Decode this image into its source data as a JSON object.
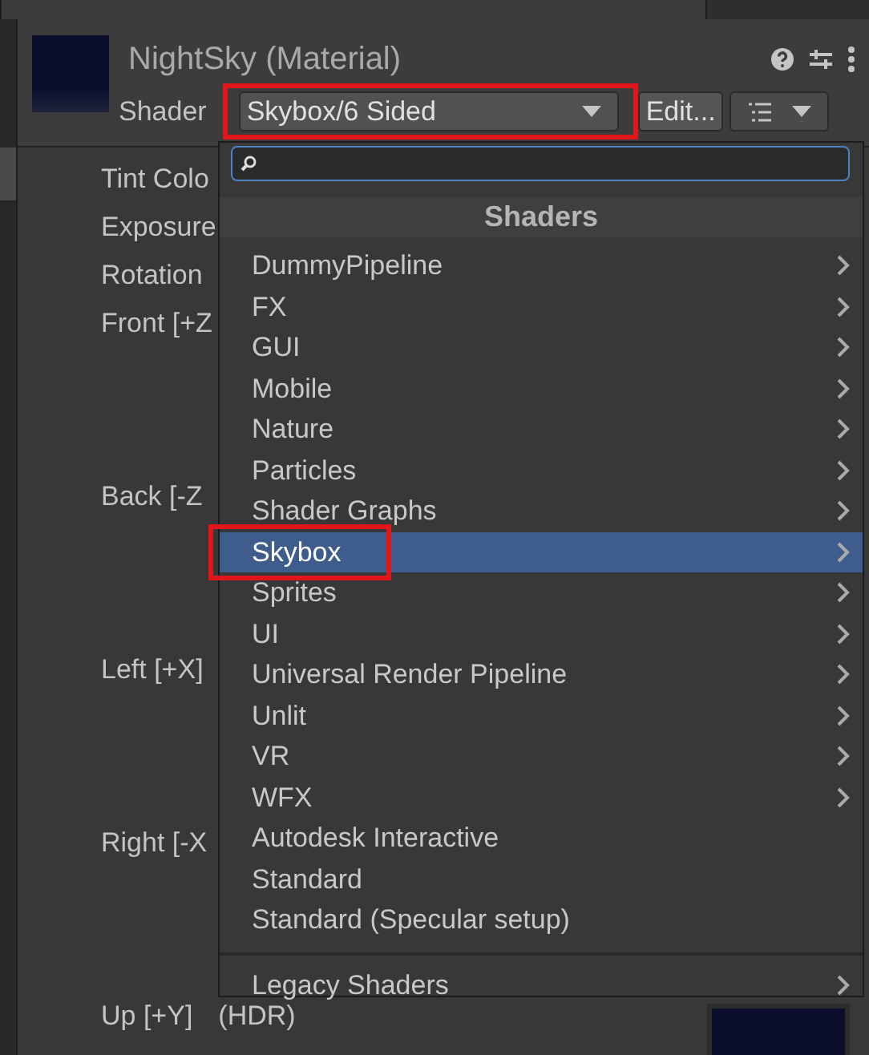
{
  "tabs": [
    {
      "selected": true
    },
    {
      "selected": false
    }
  ],
  "material": {
    "title": "NightSky (Material)",
    "shader_label": "Shader",
    "shader_value": "Skybox/6 Sided",
    "edit_button": "Edit..."
  },
  "properties": [
    {
      "label": "Tint Colo",
      "kind": "field"
    },
    {
      "label": "Exposure",
      "kind": "field"
    },
    {
      "label": "Rotation",
      "kind": "field"
    },
    {
      "label": "Front [+Z",
      "kind": "texture"
    },
    {
      "label": "Back [-Z",
      "kind": "texture"
    },
    {
      "label": "Left [+X]",
      "kind": "texture"
    },
    {
      "label": "Right [-X",
      "kind": "texture"
    },
    {
      "label": "Up [+Y]",
      "kind": "texture",
      "suffix": "(HDR)"
    }
  ],
  "shader_menu": {
    "header": "Shaders",
    "items": [
      {
        "label": "DummyPipeline",
        "submenu": true,
        "selected": false
      },
      {
        "label": "FX",
        "submenu": true,
        "selected": false
      },
      {
        "label": "GUI",
        "submenu": true,
        "selected": false
      },
      {
        "label": "Mobile",
        "submenu": true,
        "selected": false
      },
      {
        "label": "Nature",
        "submenu": true,
        "selected": false
      },
      {
        "label": "Particles",
        "submenu": true,
        "selected": false
      },
      {
        "label": "Shader Graphs",
        "submenu": true,
        "selected": false
      },
      {
        "label": "Skybox",
        "submenu": true,
        "selected": true
      },
      {
        "label": "Sprites",
        "submenu": true,
        "selected": false
      },
      {
        "label": "UI",
        "submenu": true,
        "selected": false
      },
      {
        "label": "Universal Render Pipeline",
        "submenu": true,
        "selected": false
      },
      {
        "label": "Unlit",
        "submenu": true,
        "selected": false
      },
      {
        "label": "VR",
        "submenu": true,
        "selected": false
      },
      {
        "label": "WFX",
        "submenu": true,
        "selected": false
      },
      {
        "label": "Autodesk Interactive",
        "submenu": false,
        "selected": false
      },
      {
        "label": "Standard",
        "submenu": false,
        "selected": false
      },
      {
        "label": "Standard (Specular setup)",
        "submenu": false,
        "selected": false
      }
    ],
    "footer_items": [
      {
        "label": "Legacy Shaders",
        "submenu": true,
        "selected": false
      }
    ]
  }
}
